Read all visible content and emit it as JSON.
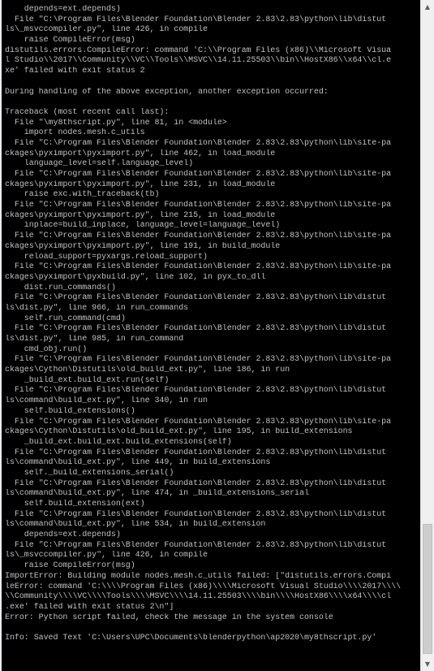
{
  "console": {
    "lines": [
      "    depends=ext.depends)",
      "  File \"C:\\Program Files\\Blender Foundation\\Blender 2.83\\2.83\\python\\lib\\distut",
      "ls\\_msvccompiler.py\", line 426, in compile",
      "    raise CompileError(msg)",
      "distutils.errors.CompileError: command 'C:\\\\Program Files (x86)\\\\Microsoft Visua",
      "l Studio\\\\2017\\\\Community\\\\VC\\\\Tools\\\\MSVC\\\\14.11.25503\\\\bin\\\\HostX86\\\\x64\\\\cl.e",
      "xe' failed with exit status 2",
      "",
      "During handling of the above exception, another exception occurred:",
      "",
      "Traceback (most recent call last):",
      "  File \"\\my8thscript.py\", line 81, in <module>",
      "    import nodes.mesh.c_utils",
      "  File \"C:\\Program Files\\Blender Foundation\\Blender 2.83\\2.83\\python\\lib\\site-pa",
      "ckages\\pyximport\\pyximport.py\", line 462, in load_module",
      "    language_level=self.language_level)",
      "  File \"C:\\Program Files\\Blender Foundation\\Blender 2.83\\2.83\\python\\lib\\site-pa",
      "ckages\\pyximport\\pyximport.py\", line 231, in load_module",
      "    raise exc.with_traceback(tb)",
      "  File \"C:\\Program Files\\Blender Foundation\\Blender 2.83\\2.83\\python\\lib\\site-pa",
      "ckages\\pyximport\\pyximport.py\", line 215, in load_module",
      "    inplace=build_inplace, language_level=language_level)",
      "  File \"C:\\Program Files\\Blender Foundation\\Blender 2.83\\2.83\\python\\lib\\site-pa",
      "ckages\\pyximport\\pyximport.py\", line 191, in build_module",
      "    reload_support=pyxargs.reload_support)",
      "  File \"C:\\Program Files\\Blender Foundation\\Blender 2.83\\2.83\\python\\lib\\site-pa",
      "ckages\\pyximport\\pyxbuild.py\", line 102, in pyx_to_dll",
      "    dist.run_commands()",
      "  File \"C:\\Program Files\\Blender Foundation\\Blender 2.83\\2.83\\python\\lib\\distut",
      "ls\\dist.py\", line 966, in run_commands",
      "    self.run_command(cmd)",
      "  File \"C:\\Program Files\\Blender Foundation\\Blender 2.83\\2.83\\python\\lib\\distut",
      "ls\\dist.py\", line 985, in run_command",
      "    cmd_obj.run()",
      "  File \"C:\\Program Files\\Blender Foundation\\Blender 2.83\\2.83\\python\\lib\\site-pa",
      "ckages\\Cython\\Distutils\\old_build_ext.py\", line 186, in run",
      "    _build_ext.build_ext.run(self)",
      "  File \"C:\\Program Files\\Blender Foundation\\Blender 2.83\\2.83\\python\\lib\\distut",
      "ls\\command\\build_ext.py\", line 340, in run",
      "    self.build_extensions()",
      "  File \"C:\\Program Files\\Blender Foundation\\Blender 2.83\\2.83\\python\\lib\\site-pa",
      "ckages\\Cython\\Distutils\\old_build_ext.py\", line 195, in build_extensions",
      "    _build_ext.build_ext.build_extensions(self)",
      "  File \"C:\\Program Files\\Blender Foundation\\Blender 2.83\\2.83\\python\\lib\\distut",
      "ls\\command\\build_ext.py\", line 449, in build_extensions",
      "    self._build_extensions_serial()",
      "  File \"C:\\Program Files\\Blender Foundation\\Blender 2.83\\2.83\\python\\lib\\distut",
      "ls\\command\\build_ext.py\", line 474, in _build_extensions_serial",
      "    self.build_extension(ext)",
      "  File \"C:\\Program Files\\Blender Foundation\\Blender 2.83\\2.83\\python\\lib\\distut",
      "ls\\command\\build_ext.py\", line 534, in build_extension",
      "    depends=ext.depends)",
      "  File \"C:\\Program Files\\Blender Foundation\\Blender 2.83\\2.83\\python\\lib\\distut",
      "ls\\_msvccompiler.py\", line 426, in compile",
      "    raise CompileError(msg)",
      "ImportError: Building module nodes.mesh.c_utils failed: [\"distutils.errors.Compi",
      "leError: command 'C:\\\\\\\\Program Files (x86)\\\\\\\\Microsoft Visual Studio\\\\\\\\2017\\\\\\\\",
      "\\\\Community\\\\\\\\VC\\\\\\\\Tools\\\\\\\\MSVC\\\\\\\\14.11.25503\\\\\\\\bin\\\\\\\\HostX86\\\\\\\\x64\\\\\\\\cl",
      ".exe' failed with exit status 2\\n\"]",
      "Error: Python script failed, check the message in the system console",
      "",
      "Info: Saved Text 'C:\\Users\\UPC\\Documents\\blenderpython\\ap2020\\my8thscript.py'"
    ]
  },
  "scrollbar": {
    "up_icon": "▲",
    "down_icon": "▼"
  }
}
